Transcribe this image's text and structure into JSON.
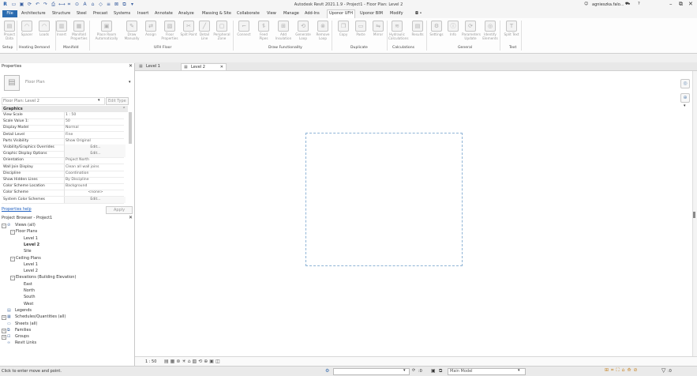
{
  "window": {
    "title": "Autodesk Revit 2021.1.9 - Project1 - Floor Plan: Level 2",
    "user": "agnieszka.falo...",
    "help": "?"
  },
  "ribbon_tabs": [
    "File",
    "Architecture",
    "Structure",
    "Steel",
    "Precast",
    "Systems",
    "Insert",
    "Annotate",
    "Analyze",
    "Massing & Site",
    "Collaborate",
    "View",
    "Manage",
    "Add-Ins",
    "Uponor UFH",
    "Uponor BIM",
    "Modify",
    "◘ •"
  ],
  "active_tab": "Uponor UFH",
  "ribbon": {
    "buttons": [
      {
        "label": "Project Data",
        "icon": "project-data-icon",
        "glyph": "▤"
      },
      {
        "label": "Spacer",
        "icon": "spacer-icon",
        "glyph": "◠"
      },
      {
        "label": "Loads",
        "icon": "loads-icon",
        "glyph": "◠"
      },
      {
        "label": "Insert",
        "icon": "insert-icon",
        "glyph": "▥"
      },
      {
        "label": "Manifold Properties",
        "icon": "manifold-properties-icon",
        "glyph": "▦"
      },
      {
        "label": "Place Room Automatically",
        "icon": "place-room-icon",
        "glyph": "▣"
      },
      {
        "label": "Draw Manually",
        "icon": "draw-manually-icon",
        "glyph": "✎"
      },
      {
        "label": "Assign",
        "icon": "assign-icon",
        "glyph": "⇄"
      },
      {
        "label": "Floor Properties",
        "icon": "floor-properties-icon",
        "glyph": "▧"
      },
      {
        "label": "Split Point",
        "icon": "split-point-icon",
        "glyph": "✂"
      },
      {
        "label": "Detail Line",
        "icon": "detail-line-icon",
        "glyph": "╱"
      },
      {
        "label": "Peripheral Zone",
        "icon": "peripheral-zone-icon",
        "glyph": "▢"
      },
      {
        "label": "Connect",
        "icon": "connect-icon",
        "glyph": "⌐"
      },
      {
        "label": "Feed Pipes",
        "icon": "feed-pipes-icon",
        "glyph": "⥮"
      },
      {
        "label": "Add Insulation",
        "icon": "add-insulation-icon",
        "glyph": "⊞"
      },
      {
        "label": "Generate Loop",
        "icon": "generate-loop-icon",
        "glyph": "⟲"
      },
      {
        "label": "Remove Loop",
        "icon": "remove-loop-icon",
        "glyph": "⊗"
      },
      {
        "label": "Copy",
        "icon": "copy-icon",
        "glyph": "❐"
      },
      {
        "label": "Paste",
        "icon": "paste-icon",
        "glyph": "▭"
      },
      {
        "label": "Mirror",
        "icon": "mirror-icon",
        "glyph": "⇋"
      },
      {
        "label": "Hydraulic Calculations",
        "icon": "hydraulic-calc-icon",
        "glyph": "≋"
      },
      {
        "label": "Results",
        "icon": "results-icon",
        "glyph": "▤"
      },
      {
        "label": "Settings",
        "icon": "settings-icon",
        "glyph": "⚙"
      },
      {
        "label": "Info",
        "icon": "info-icon",
        "glyph": "ⓘ"
      },
      {
        "label": "Parameters Update",
        "icon": "parameters-update-icon",
        "glyph": "⟳"
      },
      {
        "label": "Identify Elements",
        "icon": "identify-elements-icon",
        "glyph": "◎"
      },
      {
        "label": "Split Text",
        "icon": "split-text-icon",
        "glyph": "T"
      }
    ],
    "panels": [
      "Setup",
      "Heating Demand",
      "Manifold",
      "UFH Floor",
      "Draw Functionality",
      "Duplicate",
      "Calculations",
      "General",
      "Text"
    ]
  },
  "properties": {
    "header": "Properties",
    "type_name": "Floor Plan",
    "instance_selector": "Floor Plan: Level 2",
    "edit_type": "Edit Type",
    "section": "Graphics",
    "rows": [
      {
        "k": "View Scale",
        "v": "1 : 50"
      },
      {
        "k": "Scale Value    1:",
        "v": "50"
      },
      {
        "k": "Display Model",
        "v": "Normal"
      },
      {
        "k": "Detail Level",
        "v": "Fine"
      },
      {
        "k": "Parts Visibility",
        "v": "Show Original"
      },
      {
        "k": "Visibility/Graphics Overrides",
        "v": "Edit..."
      },
      {
        "k": "Graphic Display Options",
        "v": "Edit..."
      },
      {
        "k": "Orientation",
        "v": "Project North"
      },
      {
        "k": "Wall Join Display",
        "v": "Clean all wall joins"
      },
      {
        "k": "Discipline",
        "v": "Coordination"
      },
      {
        "k": "Show Hidden Lines",
        "v": "By Discipline"
      },
      {
        "k": "Color Scheme Location",
        "v": "Background"
      },
      {
        "k": "Color Scheme",
        "v": "<none>"
      },
      {
        "k": "System Color Schemes",
        "v": "Edit..."
      }
    ],
    "help_link": "Properties help",
    "apply": "Apply"
  },
  "browser": {
    "header": "Project Browser - Project1",
    "items": [
      {
        "label": "Views (all)",
        "level": 0,
        "exp": "−"
      },
      {
        "label": "Floor Plans",
        "level": 1,
        "exp": "−"
      },
      {
        "label": "Level 1",
        "level": 2
      },
      {
        "label": "Level 2",
        "level": 2,
        "bold": true
      },
      {
        "label": "Site",
        "level": 2
      },
      {
        "label": "Ceiling Plans",
        "level": 1,
        "exp": "−"
      },
      {
        "label": "Level 1",
        "level": 2
      },
      {
        "label": "Level 2",
        "level": 2
      },
      {
        "label": "Elevations (Building Elevation)",
        "level": 1,
        "exp": "−"
      },
      {
        "label": "East",
        "level": 2
      },
      {
        "label": "North",
        "level": 2
      },
      {
        "label": "South",
        "level": 2
      },
      {
        "label": "West",
        "level": 2
      },
      {
        "label": "Legends",
        "level": 0
      },
      {
        "label": "Schedules/Quantities (all)",
        "level": 0,
        "exp": "+"
      },
      {
        "label": "Sheets (all)",
        "level": 0
      },
      {
        "label": "Families",
        "level": 0,
        "exp": "+"
      },
      {
        "label": "Groups",
        "level": 0,
        "exp": "+"
      },
      {
        "label": "Revit Links",
        "level": 0
      }
    ]
  },
  "view_tabs": [
    {
      "label": "Level 1",
      "active": false
    },
    {
      "label": "Level 2",
      "active": true
    }
  ],
  "view_control": {
    "scale": "1 : 50"
  },
  "status": {
    "message": "Click to enter move and point.",
    "workset_value": ":0",
    "model": "Main Model",
    "filter_count": ":0"
  },
  "colors": {
    "accent": "#2b6cb0",
    "crop_region": "#8fb4d6"
  }
}
